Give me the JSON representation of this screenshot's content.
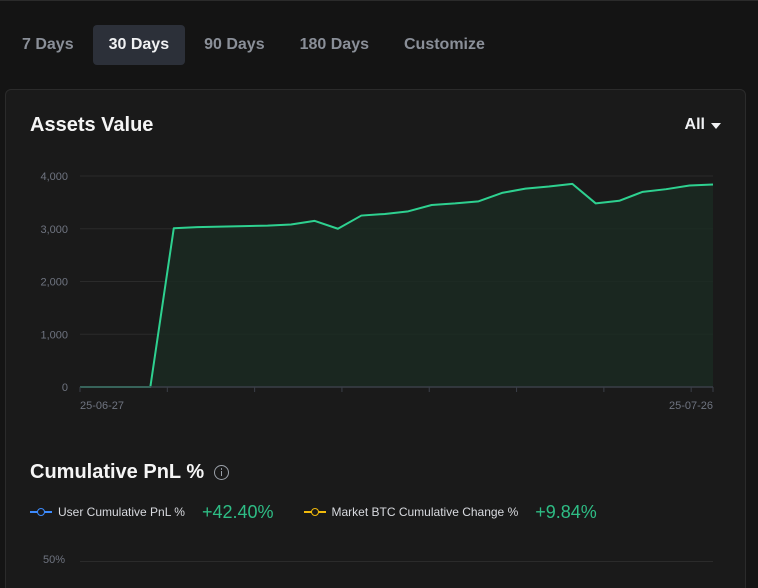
{
  "tabs": [
    {
      "label": "7 Days",
      "active": false
    },
    {
      "label": "30 Days",
      "active": true
    },
    {
      "label": "90 Days",
      "active": false
    },
    {
      "label": "180 Days",
      "active": false
    },
    {
      "label": "Customize",
      "active": false
    }
  ],
  "assets": {
    "title": "Assets Value",
    "range_label": "All"
  },
  "chart_data": {
    "type": "area",
    "xlabel": "",
    "ylabel": "",
    "x_tick_labels": [
      "25-06-27",
      "25-07-26"
    ],
    "y_ticks": [
      0,
      1000,
      2000,
      3000,
      4000
    ],
    "y_tick_labels": [
      "0",
      "1,000",
      "2,000",
      "3,000",
      "4,000"
    ],
    "ylim": [
      0,
      4000
    ],
    "grid": true,
    "colors": {
      "line": "#2ed190",
      "fill": "#1b2a22"
    },
    "series": [
      {
        "values": [
          0,
          0,
          0,
          0,
          3010,
          3030,
          3040,
          3050,
          3060,
          3080,
          3150,
          3000,
          3250,
          3280,
          3330,
          3450,
          3480,
          3520,
          3680,
          3760,
          3800,
          3850,
          3480,
          3530,
          3700,
          3750,
          3820,
          3840
        ]
      }
    ]
  },
  "pnl": {
    "title": "Cumulative PnL %",
    "legend": [
      {
        "label": "User Cumulative PnL %",
        "value": "+42.40%",
        "color": "#3d8bfd"
      },
      {
        "label": "Market BTC Cumulative Change %",
        "value": "+9.84%",
        "color": "#f0b90b"
      }
    ],
    "y_tick": "50%"
  }
}
